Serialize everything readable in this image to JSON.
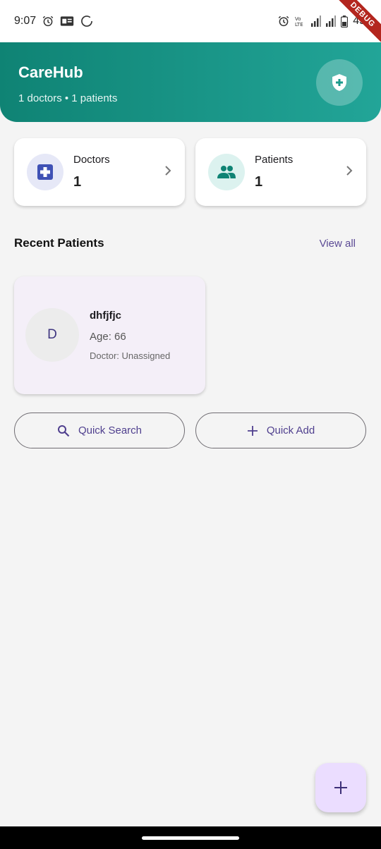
{
  "status_bar": {
    "time": "9:07",
    "battery": "45",
    "icons": [
      "alarm-icon",
      "gallery-icon",
      "loading-circle-icon",
      "alarm-icon",
      "volte-icon",
      "signal-icon",
      "signal-icon",
      "battery-icon"
    ]
  },
  "debug_ribbon": "DEBUG",
  "header": {
    "title": "CareHub",
    "subtitle": "1 doctors • 1 patients",
    "badge_icon": "shield-plus-icon"
  },
  "stats": {
    "doctors": {
      "label": "Doctors",
      "value": "1",
      "icon": "medical-cross-icon"
    },
    "patients": {
      "label": "Patients",
      "value": "1",
      "icon": "people-icon"
    }
  },
  "recent": {
    "title": "Recent Patients",
    "view_all": "View all",
    "patients": [
      {
        "initial": "D",
        "name": "dhfjfjc",
        "age": "Age: 66",
        "doctor": "Doctor: Unassigned"
      }
    ]
  },
  "actions": {
    "search_label": "Quick Search",
    "add_label": "Quick Add"
  },
  "colors": {
    "header_start": "#0f8374",
    "header_end": "#22a598",
    "accent": "#5b4a95",
    "doctor_icon": "#3f51b5",
    "patient_icon": "#0f8374",
    "fab_bg": "#ebddff",
    "card_bg": "#f4eff8"
  }
}
